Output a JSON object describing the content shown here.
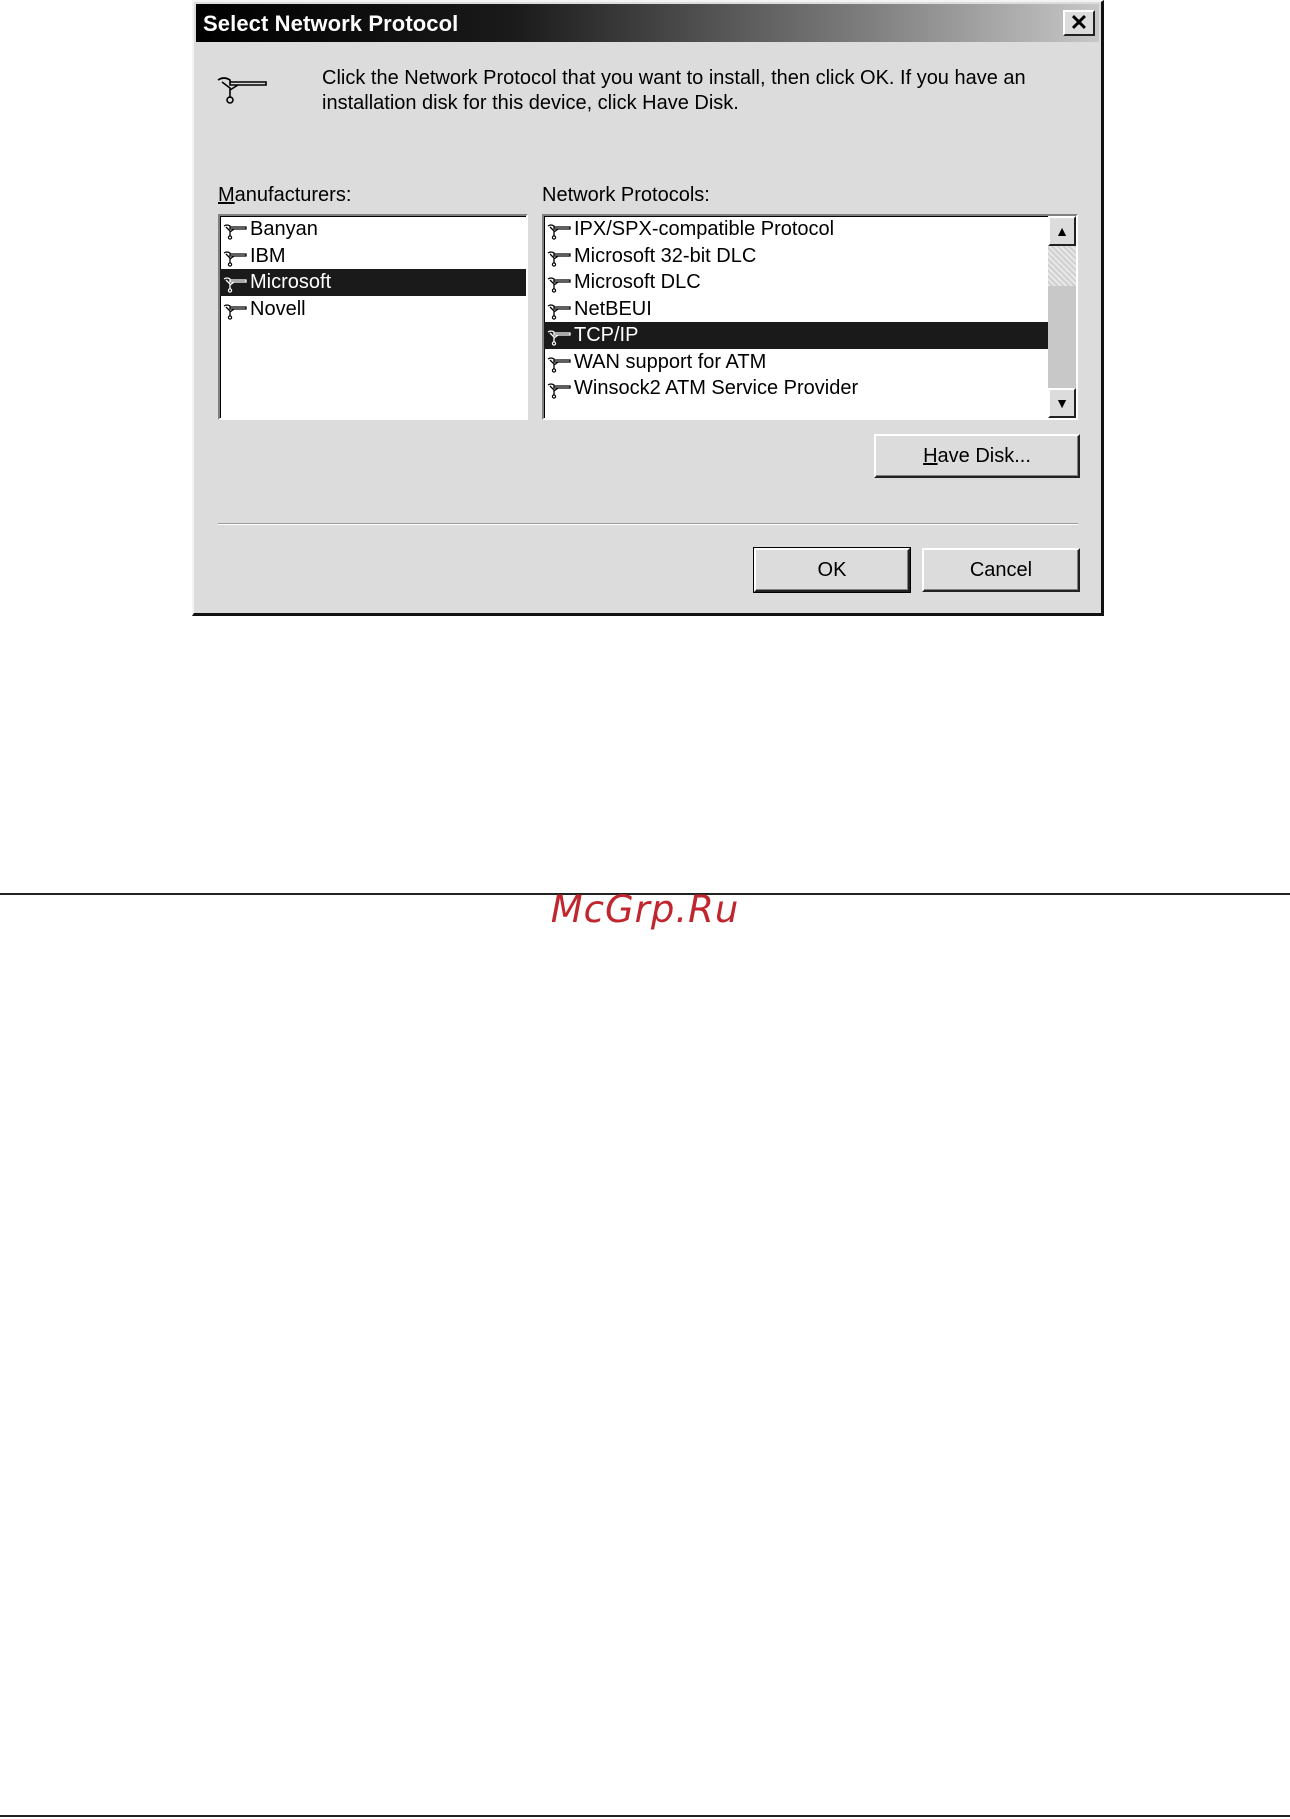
{
  "dialog": {
    "title": "Select Network Protocol",
    "close_label": "✕",
    "instruction": "Click the Network Protocol that you want to install, then click OK. If you have an installation disk for this device, click Have Disk.",
    "header_icon": "network-protocol-icon"
  },
  "manufacturers": {
    "label_accel": "M",
    "label_rest": "anufacturers:",
    "items": [
      {
        "label": "Banyan"
      },
      {
        "label": "IBM"
      },
      {
        "label": "Microsoft",
        "selected": true
      },
      {
        "label": "Novell"
      }
    ]
  },
  "protocols": {
    "label": "Network Protocols:",
    "items": [
      {
        "label": "IPX/SPX-compatible Protocol"
      },
      {
        "label": "Microsoft 32-bit DLC"
      },
      {
        "label": "Microsoft DLC"
      },
      {
        "label": "NetBEUI"
      },
      {
        "label": "TCP/IP",
        "selected": true
      },
      {
        "label": "WAN support for ATM"
      },
      {
        "label": "Winsock2 ATM Service Provider"
      }
    ],
    "scroll_up_icon": "▲",
    "scroll_down_icon": "▼"
  },
  "buttons": {
    "have_disk_accel": "H",
    "have_disk_rest": "ave Disk...",
    "ok": "OK",
    "cancel": "Cancel"
  },
  "watermark": "McGrp.Ru",
  "colors": {
    "dialog_face": "#dcdcdc",
    "selection": "#1a1a1a",
    "watermark": "#c0262d"
  }
}
